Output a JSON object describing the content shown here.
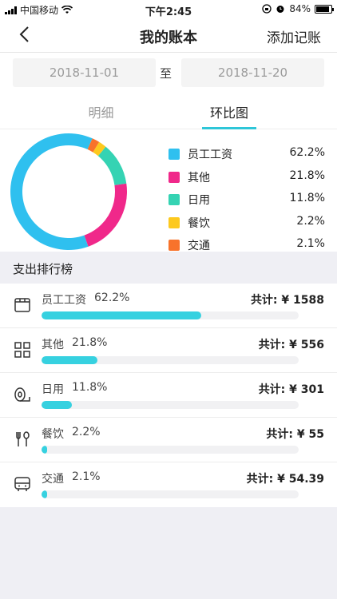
{
  "status_bar": {
    "carrier": "中国移动",
    "time": "下午2:45",
    "battery": "84%"
  },
  "nav": {
    "title": "我的账本",
    "action_label": "添加记账"
  },
  "date_range": {
    "from": "2018-11-01",
    "separator": "至",
    "to": "2018-11-20"
  },
  "tabs": [
    {
      "label": "明细",
      "active": false
    },
    {
      "label": "环比图",
      "active": true
    }
  ],
  "chart_data": {
    "type": "pie",
    "title": "",
    "series": [
      {
        "name": "员工工资",
        "value": 62.2,
        "label": "62.2%",
        "color": "#2fc0ef"
      },
      {
        "name": "其他",
        "value": 21.8,
        "label": "21.8%",
        "color": "#f0288a"
      },
      {
        "name": "日用",
        "value": 11.8,
        "label": "11.8%",
        "color": "#35d3b3"
      },
      {
        "name": "餐饮",
        "value": 2.2,
        "label": "2.2%",
        "color": "#fdc91e"
      },
      {
        "name": "交通",
        "value": 2.1,
        "label": "2.1%",
        "color": "#f8732b"
      }
    ],
    "legend_position": "right"
  },
  "ranking": {
    "title": "支出排行榜",
    "items": [
      {
        "name": "员工工资",
        "percent": "62.2%",
        "total": "共计: ¥ 1588",
        "fill": 0.622,
        "icon": "wallet-icon"
      },
      {
        "name": "其他",
        "percent": "21.8%",
        "total": "共计: ¥ 556",
        "fill": 0.218,
        "icon": "grid-icon"
      },
      {
        "name": "日用",
        "percent": "11.8%",
        "total": "共计: ¥ 301",
        "fill": 0.118,
        "icon": "tissue-roll-icon"
      },
      {
        "name": "餐饮",
        "percent": "2.2%",
        "total": "共计: ¥ 55",
        "fill": 0.022,
        "icon": "fork-spoon-icon"
      },
      {
        "name": "交通",
        "percent": "2.1%",
        "total": "共计: ¥ 54.39",
        "fill": 0.021,
        "icon": "bus-icon"
      }
    ],
    "bar_color": "#36d1e0"
  }
}
